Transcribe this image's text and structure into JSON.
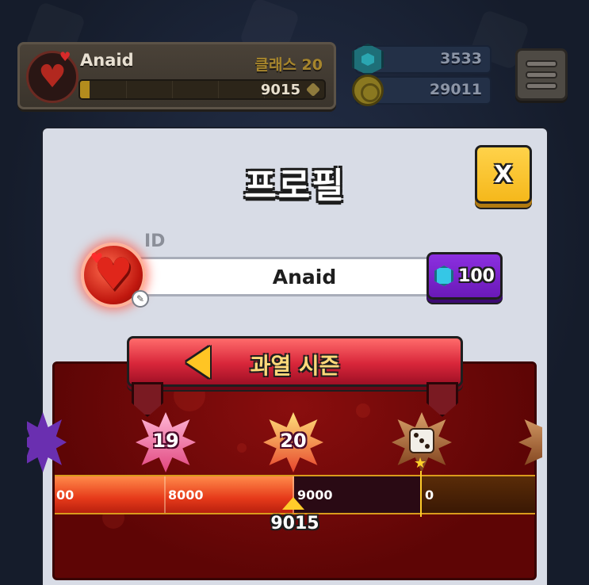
{
  "hud": {
    "player_name": "Anaid",
    "class_label": "클래스 20",
    "xp_value": "9015",
    "xp_progress": 0.04,
    "gems": "3533",
    "coins": "29011"
  },
  "profile": {
    "title": "프로필",
    "close_label": "X",
    "id_label": "ID",
    "id_value": "Anaid",
    "rename_cost": "100"
  },
  "season": {
    "title": "과열 시즌",
    "badges": [
      "19",
      "20"
    ],
    "ticks": [
      "00",
      "8000",
      "9000",
      "0"
    ],
    "current_value": "9015"
  },
  "colors": {
    "accent_yellow": "#ffc524",
    "season_red": "#d8263a",
    "rename_purple": "#8c2fe0",
    "gem_cyan": "#35c7e6"
  }
}
